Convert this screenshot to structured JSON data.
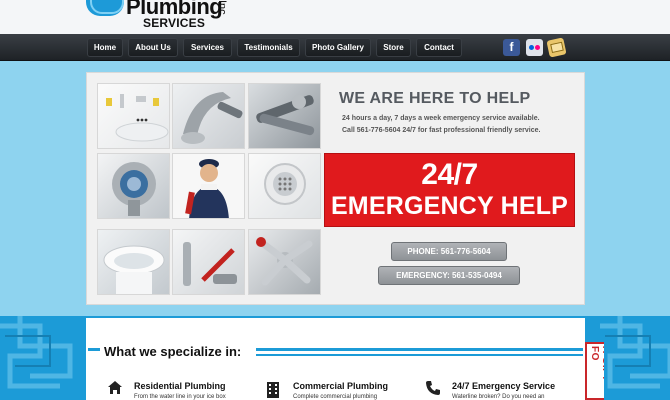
{
  "brand": {
    "name": "Plumbing",
    "inc": "Inc.",
    "subtitle": "SERVICES"
  },
  "nav": {
    "items": [
      {
        "label": "Home"
      },
      {
        "label": "About Us"
      },
      {
        "label": "Services"
      },
      {
        "label": "Testimonials"
      },
      {
        "label": "Photo Gallery"
      },
      {
        "label": "Store"
      },
      {
        "label": "Contact"
      }
    ],
    "social": [
      {
        "icon": "facebook-icon",
        "glyph": "f"
      },
      {
        "icon": "flickr-icon"
      },
      {
        "icon": "mail-icon"
      }
    ]
  },
  "hero": {
    "title": "WE ARE HERE TO HELP",
    "line1": "24 hours a day, 7 days a week emergency service available.",
    "line2": "Call 561-776-5604 24/7 for fast professional friendly service.",
    "banner_top": "24/7",
    "banner_bottom": "EMERGENCY HELP",
    "phone_label": "PHONE: 561-776-5604",
    "emergency_label": "EMERGENCY: 561-535-0494",
    "photos": [
      "faucet-photo",
      "wrench-faucet-photo",
      "tools-photo",
      "shower-photo",
      "plumber-photo",
      "drain-photo",
      "toilet-photo",
      "sprayer-photo",
      "handle-photo"
    ]
  },
  "specialize": {
    "title": "What we specialize in:",
    "services": [
      {
        "icon": "house-icon",
        "title": "Residential Plumbing",
        "desc": "From the water line in your ice box"
      },
      {
        "icon": "building-icon",
        "title": "Commercial Plumbing",
        "desc": "Complete commercial plumbing"
      },
      {
        "icon": "phone-icon",
        "title": "24/7 Emergency Service",
        "desc": "Waterline broken? Do you need an"
      }
    ]
  },
  "gift_tab": "A GIFT FO",
  "colors": {
    "accent": "#1c9bd7",
    "emergency_red": "#e01a1d",
    "nav_dark": "#2b2f34"
  }
}
